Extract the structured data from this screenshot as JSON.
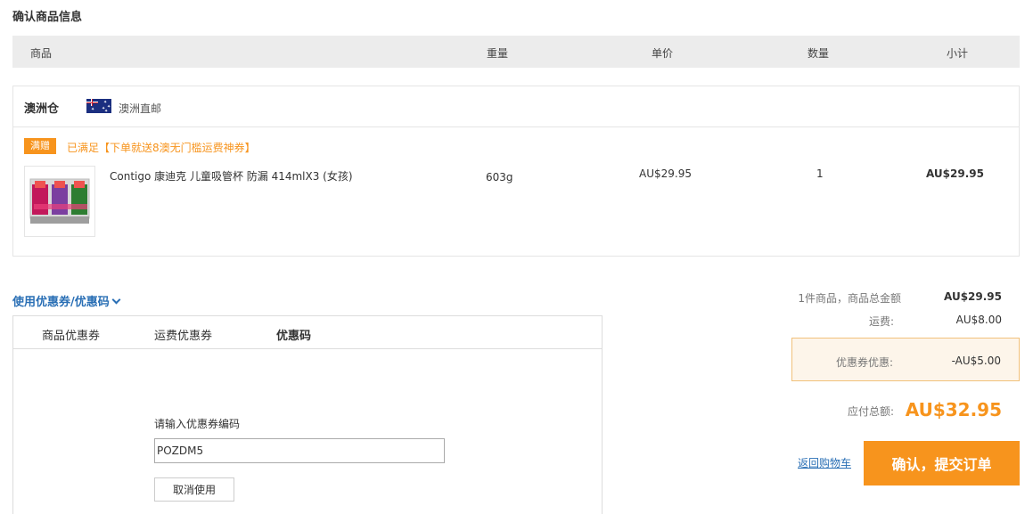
{
  "page": {
    "section_title": "确认商品信息"
  },
  "table_header": {
    "product": "商品",
    "weight": "重量",
    "unit_price": "单价",
    "quantity": "数量",
    "subtotal": "小计"
  },
  "store": {
    "name": "澳洲仓",
    "flag_icon": "australia-flag-icon",
    "ship_type": "澳洲直邮",
    "promo_tag": "满赠",
    "promo_text": "已满足【下单就送8澳无门槛运费神券】"
  },
  "product": {
    "name": "Contigo 康迪克 儿童吸管杯 防漏 414mlX3 (女孩)",
    "weight": "603g",
    "unit_price": "AU$29.95",
    "quantity": "1",
    "subtotal": "AU$29.95"
  },
  "coupon": {
    "toggle_label": "使用优惠券/优惠码",
    "tabs": [
      {
        "label": "商品优惠券",
        "active": false
      },
      {
        "label": "运费优惠券",
        "active": false
      },
      {
        "label": "优惠码",
        "active": true
      }
    ],
    "code_label": "请输入优惠券编码",
    "code_value": "POZDM5",
    "cancel_label": "取消使用"
  },
  "summary": {
    "items_label": "1件商品，商品总金额",
    "items_value": "AU$29.95",
    "shipping_label": "运费:",
    "shipping_value": "AU$8.00",
    "discount_label": "优惠券优惠:",
    "discount_value": "-AU$5.00",
    "total_label": "应付总额:",
    "total_value": "AU$32.95",
    "back_link": "返回购物车",
    "submit_label": "确认，提交订单"
  },
  "colors": {
    "accent": "#f7941d",
    "link": "#2a6fb5",
    "header_bg": "#ececec",
    "discount_bg": "#fdf5ea"
  }
}
